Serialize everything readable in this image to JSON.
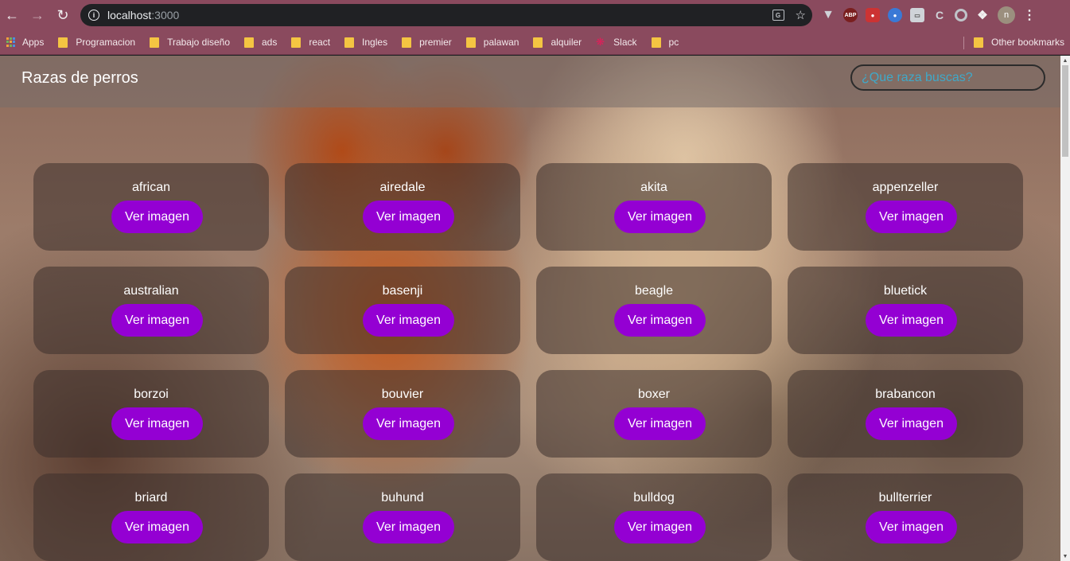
{
  "browser": {
    "url_host": "localhost",
    "url_port": ":3000",
    "avatar_letter": "n",
    "extensions": {
      "abp": "ABP",
      "c": "C"
    }
  },
  "bookmarks": {
    "items": [
      "Apps",
      "Programacion",
      "Trabajo diseño",
      "ads",
      "react",
      "Ingles",
      "premier",
      "palawan",
      "alquiler",
      "Slack",
      "pc"
    ],
    "other": "Other bookmarks"
  },
  "app": {
    "title": "Razas de perros",
    "search_placeholder": "¿Que raza buscas?"
  },
  "breeds": [
    {
      "name": "african",
      "button": "Ver imagen"
    },
    {
      "name": "airedale",
      "button": "Ver imagen"
    },
    {
      "name": "akita",
      "button": "Ver imagen"
    },
    {
      "name": "appenzeller",
      "button": "Ver imagen"
    },
    {
      "name": "australian",
      "button": "Ver imagen"
    },
    {
      "name": "basenji",
      "button": "Ver imagen"
    },
    {
      "name": "beagle",
      "button": "Ver imagen"
    },
    {
      "name": "bluetick",
      "button": "Ver imagen"
    },
    {
      "name": "borzoi",
      "button": "Ver imagen"
    },
    {
      "name": "bouvier",
      "button": "Ver imagen"
    },
    {
      "name": "boxer",
      "button": "Ver imagen"
    },
    {
      "name": "brabancon",
      "button": "Ver imagen"
    },
    {
      "name": "briard",
      "button": "Ver imagen"
    },
    {
      "name": "buhund",
      "button": "Ver imagen"
    },
    {
      "name": "bulldog",
      "button": "Ver imagen"
    },
    {
      "name": "bullterrier",
      "button": "Ver imagen"
    }
  ],
  "colors": {
    "chrome": "#8a4a5e",
    "button": "#9400d3",
    "search_text": "#3fa9c9"
  }
}
